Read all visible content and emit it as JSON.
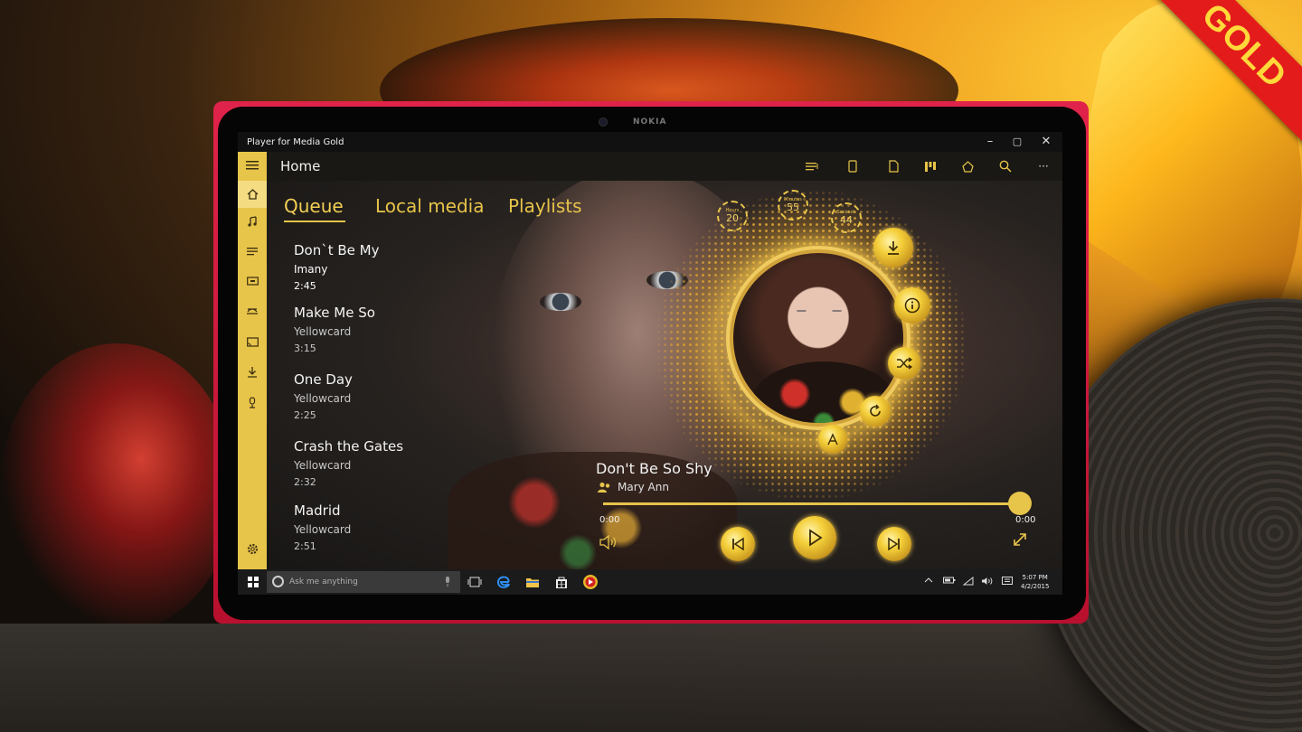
{
  "badge": "GOLD",
  "device": {
    "brand": "NOKIA"
  },
  "window": {
    "title": "Player for Media Gold",
    "controls": {
      "minimize": "–",
      "maximize": "▢",
      "close": "✕"
    }
  },
  "header": {
    "title": "Home",
    "icons": [
      "equalizer-icon",
      "device-icon",
      "file-icon",
      "visualizer-icon",
      "store-icon",
      "search-icon",
      "more-icon"
    ],
    "more_label": "···"
  },
  "sidebar": {
    "icons": [
      "menu-icon",
      "home-icon",
      "music-icon",
      "playlist-icon",
      "video-icon",
      "podcast-icon",
      "cast-icon",
      "download-icon",
      "microphone-icon",
      "settings-icon"
    ]
  },
  "tabs": [
    {
      "label": "Queue",
      "active": true
    },
    {
      "label": "Local media",
      "active": false
    },
    {
      "label": "Playlists",
      "active": false
    }
  ],
  "queue": [
    {
      "title": "Don`t Be My",
      "artist": "Imany",
      "duration": "2:45",
      "current": true
    },
    {
      "title": "Make Me So",
      "artist": "Yellowcard",
      "duration": "3:15"
    },
    {
      "title": "One Day",
      "artist": "Yellowcard",
      "duration": "2:25"
    },
    {
      "title": "Crash the Gates",
      "artist": "Yellowcard",
      "duration": "2:32"
    },
    {
      "title": "Madrid",
      "artist": "Yellowcard",
      "duration": "2:51"
    }
  ],
  "sleep_timer": {
    "hours_label": "Hours",
    "hours": "20",
    "minutes_label": "Minutes",
    "minutes": "55",
    "seconds_label": "Seconds",
    "seconds": "44"
  },
  "now_playing": {
    "title": "Don't Be So Shy",
    "artist": "Mary Ann",
    "elapsed": "0:00",
    "total": "0:00",
    "progress": 1.0
  },
  "colors": {
    "accent": "#E7C44A",
    "ribbon": "#E41B1B",
    "device": "#D01A3C"
  },
  "taskbar": {
    "search_placeholder": "Ask me anything",
    "time": "5:07 PM",
    "date": "4/2/2015"
  }
}
